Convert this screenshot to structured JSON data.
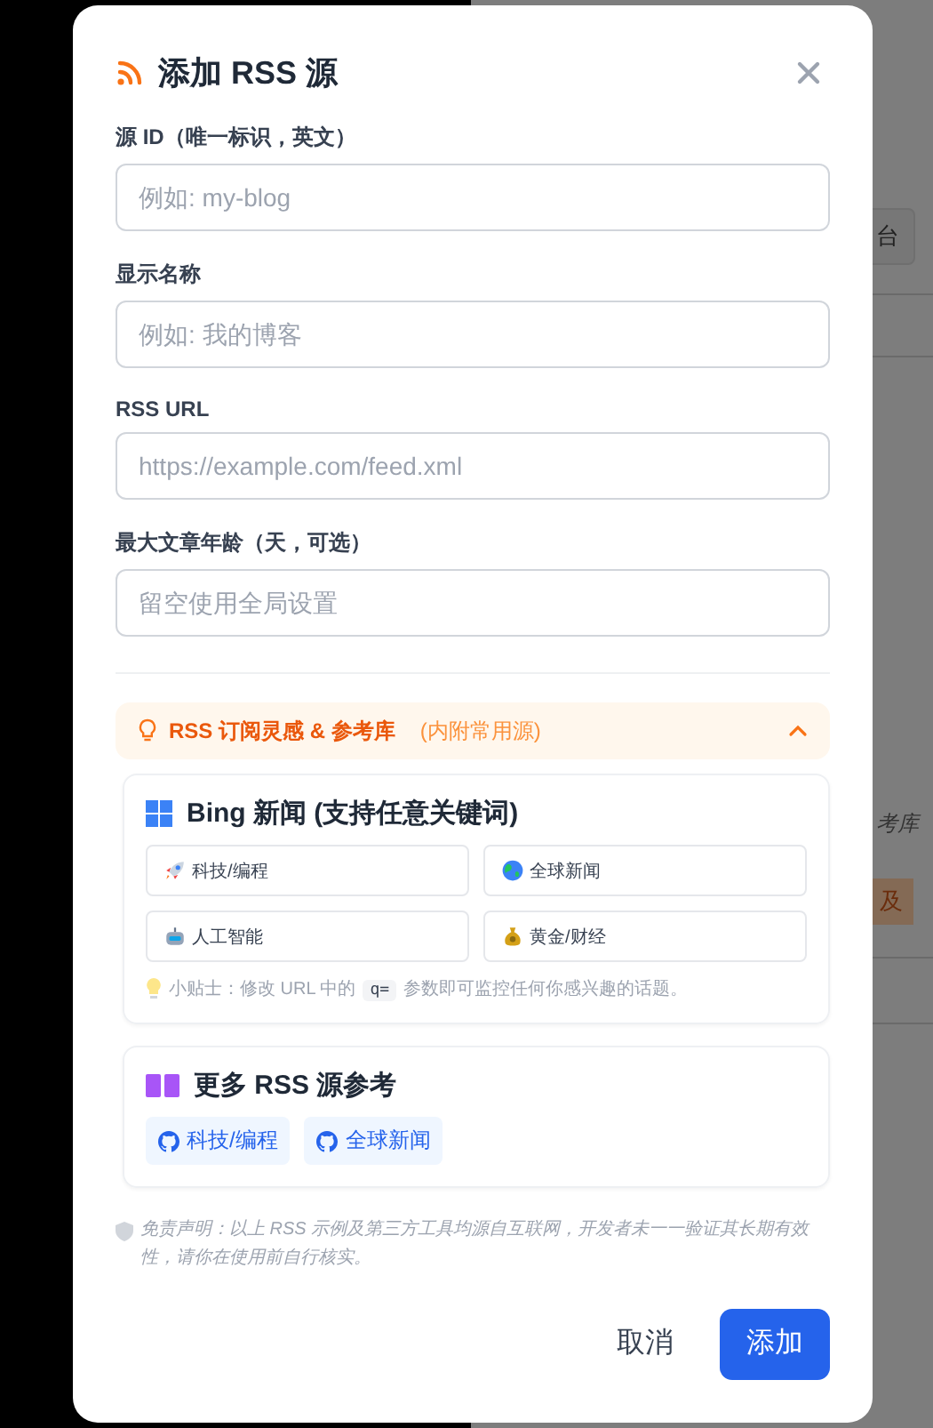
{
  "background": {
    "fragments": [
      "台",
      "考库",
      "及"
    ]
  },
  "dialog": {
    "title": "添加 RSS 源",
    "fields": [
      {
        "label": "源 ID（唯一标识，英文）",
        "placeholder": "例如: my-blog"
      },
      {
        "label": "显示名称",
        "placeholder": "例如: 我的博客"
      },
      {
        "label": "RSS URL",
        "placeholder": "https://example.com/feed.xml"
      },
      {
        "label": "最大文章年龄（天，可选）",
        "placeholder": "留空使用全局设置"
      }
    ],
    "inspiration": {
      "title": "RSS 订阅灵感 & 参考库",
      "note": "(内附常用源)",
      "expanded": true,
      "bing": {
        "title": "Bing 新闻 (支持任意关键词)",
        "chips": [
          {
            "kind": "rocket",
            "label": "科技/编程"
          },
          {
            "kind": "globe",
            "label": "全球新闻"
          },
          {
            "kind": "robot",
            "label": "人工智能"
          },
          {
            "kind": "money",
            "label": "黄金/财经"
          }
        ],
        "tip": {
          "before": "小贴士：修改 URL 中的",
          "code": "q=",
          "after": "参数即可监控任何你感兴趣的话题。"
        }
      },
      "more": {
        "title": "更多 RSS 源参考",
        "links": [
          "科技/编程",
          "全球新闻"
        ]
      }
    },
    "disclaimer": "免责声明：以上 RSS 示例及第三方工具均源自互联网，开发者未一一验证其长期有效性，请你在使用前自行核实。",
    "buttons": {
      "cancel": "取消",
      "confirm": "添加"
    }
  }
}
